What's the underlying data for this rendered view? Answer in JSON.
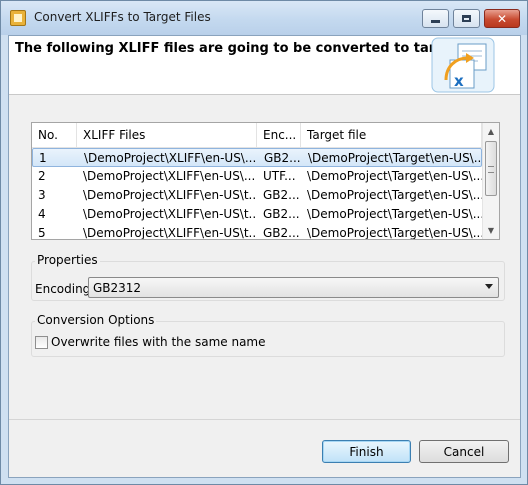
{
  "window": {
    "title": "Convert XLIFFs to Target Files",
    "controls": [
      "minimize-icon",
      "maximize-icon",
      "close-icon"
    ],
    "close_glyph": "✕"
  },
  "header": {
    "title": "The following XLIFF files are going to be converted to target files",
    "image_icon": "xliff-convert-icon",
    "image_letter": "x"
  },
  "table": {
    "columns": [
      "No.",
      "XLIFF Files",
      "Enc...",
      "Target file"
    ],
    "rows": [
      {
        "no": "1",
        "xliff": "\\DemoProject\\XLIFF\\en-US\\...",
        "enc": "GB2...",
        "target": "\\DemoProject\\Target\\en-US\\..."
      },
      {
        "no": "2",
        "xliff": "\\DemoProject\\XLIFF\\en-US\\...",
        "enc": "UTF...",
        "target": "\\DemoProject\\Target\\en-US\\..."
      },
      {
        "no": "3",
        "xliff": "\\DemoProject\\XLIFF\\en-US\\t...",
        "enc": "GB2...",
        "target": "\\DemoProject\\Target\\en-US\\..."
      },
      {
        "no": "4",
        "xliff": "\\DemoProject\\XLIFF\\en-US\\t...",
        "enc": "GB2...",
        "target": "\\DemoProject\\Target\\en-US\\..."
      },
      {
        "no": "5",
        "xliff": "\\DemoProject\\XLIFF\\en-US\\t...",
        "enc": "GB2...",
        "target": "\\DemoProject\\Target\\en-US\\..."
      }
    ],
    "selected_row": 0
  },
  "properties": {
    "group_label": "Properties",
    "encoding_label": "Encoding",
    "encoding_value": "GB2312"
  },
  "conversion": {
    "group_label": "Conversion Options",
    "overwrite_label": "Overwrite files with the same name",
    "overwrite_checked": false
  },
  "buttons": {
    "finish": "Finish",
    "cancel": "Cancel"
  },
  "colors": {
    "title_bar": "#c4d9ef",
    "selection": "#d3e6f8",
    "default_button": "#c0e2f8",
    "close_button": "#c94b31"
  }
}
